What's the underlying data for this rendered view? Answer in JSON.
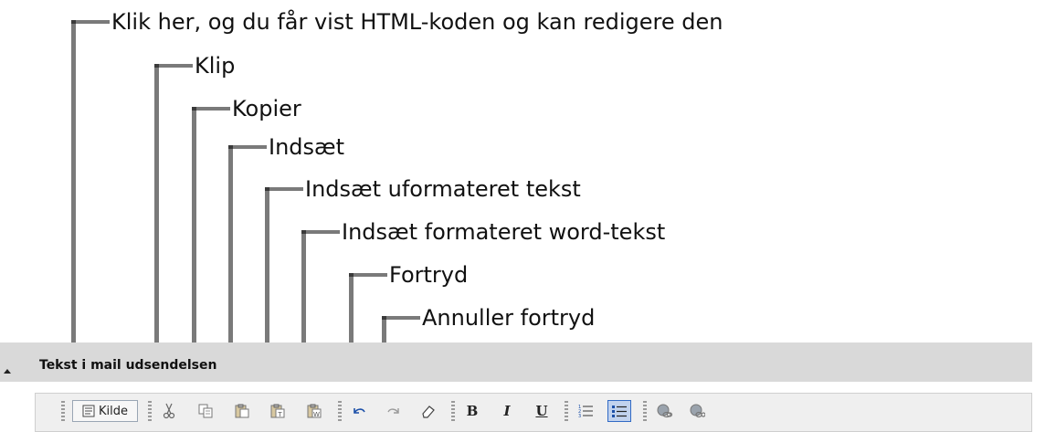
{
  "annotations": {
    "source": "Klik her, og du får vist HTML-koden og kan redigere den",
    "cut": "Klip",
    "copy": "Kopier",
    "paste": "Indsæt",
    "paste_plain": "Indsæt uformateret tekst",
    "paste_word": "Indsæt formateret word-tekst",
    "undo": "Fortryd",
    "redo": "Annuller fortryd"
  },
  "panel": {
    "title": "Tekst i mail udsendelsen"
  },
  "toolbar": {
    "source_label": "Kilde",
    "buttons": [
      {
        "icon": "source-icon",
        "label": "Kilde"
      },
      {
        "icon": "scissors-icon"
      },
      {
        "icon": "copy-icon"
      },
      {
        "icon": "paste-icon"
      },
      {
        "icon": "paste-text-icon"
      },
      {
        "icon": "paste-word-icon"
      },
      {
        "icon": "undo-icon"
      },
      {
        "icon": "redo-icon"
      },
      {
        "icon": "eraser-icon"
      },
      {
        "icon": "bold-icon",
        "label": "B"
      },
      {
        "icon": "italic-icon",
        "label": "I"
      },
      {
        "icon": "underline-icon",
        "label": "U"
      },
      {
        "icon": "numbered-list-icon"
      },
      {
        "icon": "bulleted-list-icon",
        "active": true
      },
      {
        "icon": "link-icon"
      },
      {
        "icon": "unlink-icon"
      }
    ],
    "bold_label": "B",
    "italic_label": "I",
    "underline_label": "U"
  },
  "colors": {
    "callout_line": "#7a7a7a",
    "panel_header": "#d9d9d9",
    "active_button": "#c1d2ee"
  }
}
